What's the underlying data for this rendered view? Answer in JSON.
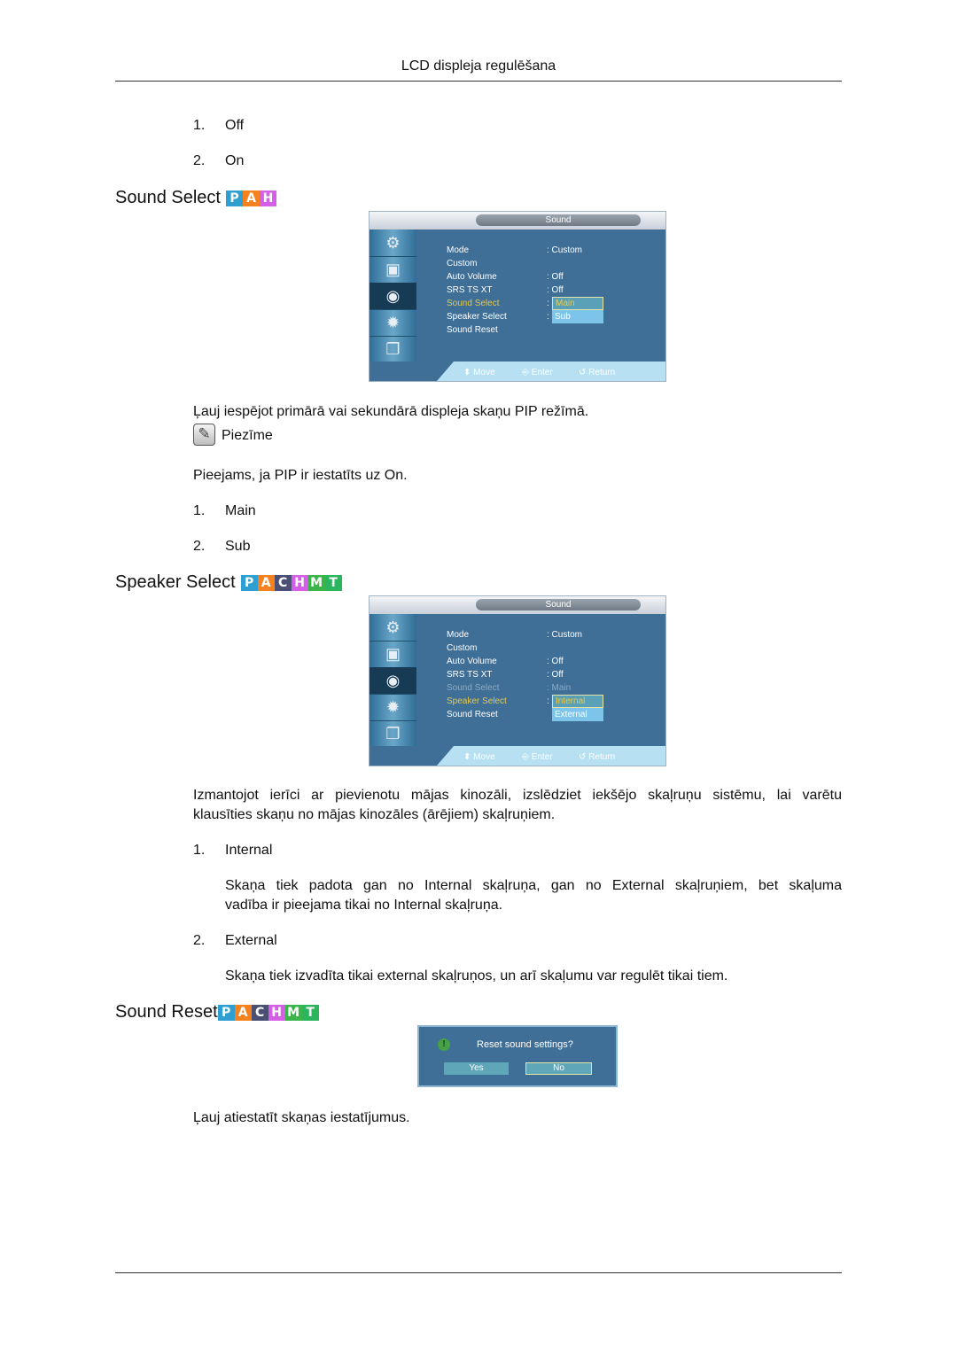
{
  "header": {
    "title": "LCD displeja regulēšana"
  },
  "intro_list": [
    {
      "num": "1.",
      "label": "Off"
    },
    {
      "num": "2.",
      "label": "On"
    }
  ],
  "badge_colors": {
    "P": "#2e9fd0",
    "A": "#f5821f",
    "C": "#4b4f73",
    "H": "#d55fe6",
    "M": "#3bb54a",
    "T": "#2bb55d"
  },
  "sections": {
    "sound_select": {
      "title": "Sound Select",
      "badges": [
        "P",
        "A",
        "H"
      ],
      "osd": {
        "tab": "Sound",
        "rows": [
          {
            "label": "Mode",
            "value": ": Custom"
          },
          {
            "label": "Custom",
            "value": ""
          },
          {
            "label": "Auto Volume",
            "value": ": Off"
          },
          {
            "label": "SRS TS XT",
            "value": ": Off"
          },
          {
            "label": "Sound Select",
            "value": ":"
          },
          {
            "label": "Speaker Select",
            "value": ":"
          },
          {
            "label": "Sound Reset",
            "value": ""
          }
        ],
        "dropdown": [
          "Main",
          "Sub"
        ],
        "selected": "Main",
        "hints": {
          "move": "Move",
          "enter": "Enter",
          "return": "Return"
        }
      },
      "description": "Ļauj iespējot primārā vai sekundārā displeja skaņu PIP režīmā.",
      "note_label": "Piezīme",
      "note_text": "Pieejams, ja PIP ir iestatīts uz On.",
      "options": [
        {
          "num": "1.",
          "label": "Main"
        },
        {
          "num": "2.",
          "label": "Sub"
        }
      ]
    },
    "speaker_select": {
      "title": "Speaker Select",
      "badges": [
        "P",
        "A",
        "C",
        "H",
        "M",
        "T"
      ],
      "osd": {
        "tab": "Sound",
        "rows": [
          {
            "label": "Mode",
            "value": ": Custom"
          },
          {
            "label": "Custom",
            "value": ""
          },
          {
            "label": "Auto Volume",
            "value": ": Off"
          },
          {
            "label": "SRS TS XT",
            "value": ": Off"
          },
          {
            "label": "Sound Select",
            "value": ": Main"
          },
          {
            "label": "Speaker Select",
            "value": ":"
          },
          {
            "label": "Sound Reset",
            "value": ""
          }
        ],
        "dropdown": [
          "Internal",
          "External"
        ],
        "selected": "Internal",
        "hints": {
          "move": "Move",
          "enter": "Enter",
          "return": "Return"
        }
      },
      "description_line1": "Izmantojot ierīci ar pievienotu mājas kinozāli, izslēdziet iekšējo skaļruņu sistēmu, lai varētu",
      "description_line2": "klausīties skaņu no mājas kinozāles (ārējiem) skaļruņiem.",
      "options": [
        {
          "num": "1.",
          "label": "Internal",
          "text_line1": "Skaņa tiek padota gan no Internal skaļruņa, gan no External skaļruņiem, bet skaļuma",
          "text_line2": "vadība ir pieejama tikai no Internal skaļruņa."
        },
        {
          "num": "2.",
          "label": "External",
          "text_line1": "Skaņa tiek izvadīta tikai external skaļruņos, un arī skaļumu var regulēt tikai tiem."
        }
      ]
    },
    "sound_reset": {
      "title": "Sound Reset",
      "badges": [
        "P",
        "A",
        "C",
        "H",
        "M",
        "T"
      ],
      "dialog": {
        "icon": "!",
        "title": "Reset sound settings?",
        "yes": "Yes",
        "no": "No"
      },
      "description": "Ļauj atiestatīt skaņas iestatījumus."
    }
  }
}
